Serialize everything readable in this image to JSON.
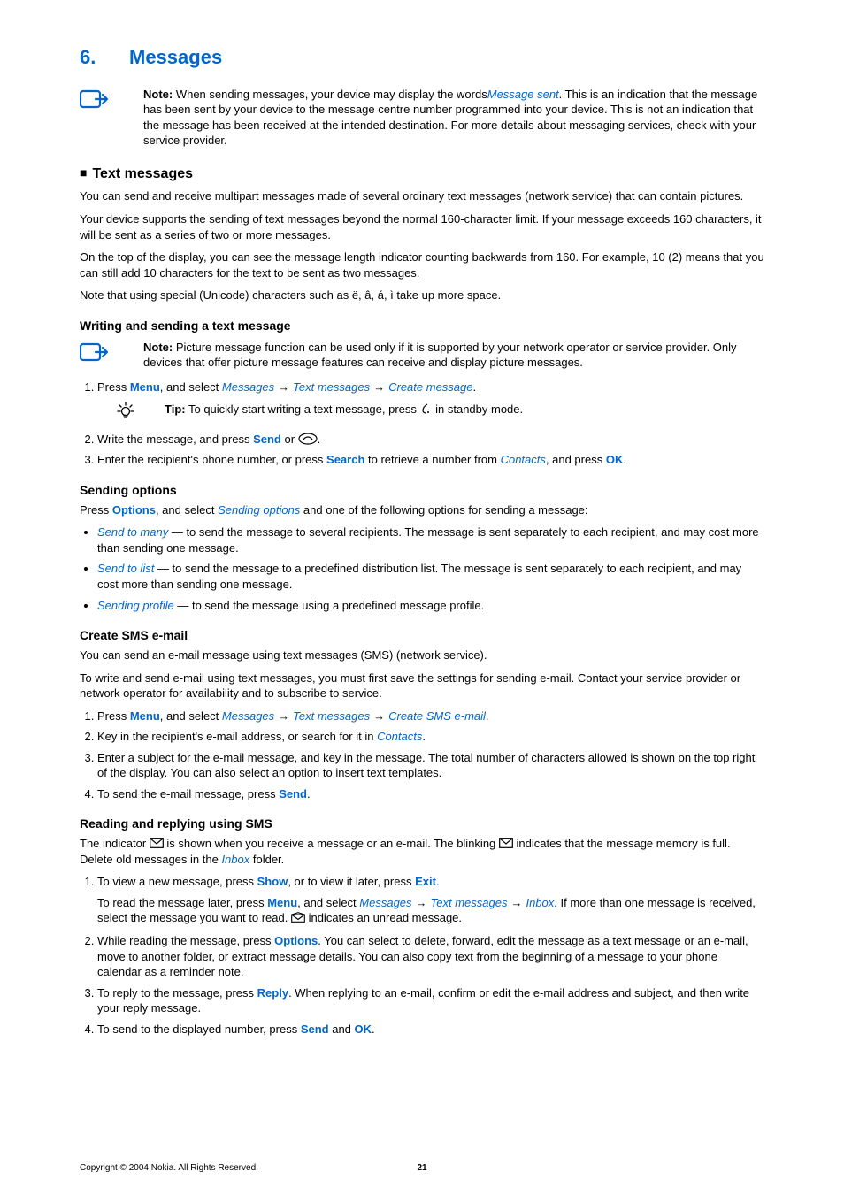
{
  "chapter": {
    "number": "6.",
    "title": "Messages"
  },
  "note1": {
    "label": "Note:",
    "text_before": " When sending messages, your device may display the words",
    "italic": "Message sent",
    "text_after": ". This is an indication that the message has been sent by your device to the message centre number programmed into your device. This is not an indication that the message has been received at the intended destination. For more details about messaging services, check with your service provider."
  },
  "section_text": {
    "title": "Text messages"
  },
  "p_intro1": "You can send and receive multipart messages made of several ordinary text messages (network service) that can contain pictures.",
  "p_intro2": "Your device supports the sending of text messages beyond the normal 160-character limit. If your message exceeds 160 characters, it will be sent as a series of two or more messages.",
  "p_intro3": "On the top of the display, you can see the message length indicator counting backwards from 160. For example, 10 (2) means that you can still add 10 characters for the text to be sent as two messages.",
  "p_intro4": "Note that using special (Unicode) characters such as ë, â, á, ì take up more space.",
  "writing": {
    "title": "Writing and sending a text message",
    "note": {
      "label": "Note:",
      "text": " Picture message function can be used only if it is supported by your network operator or service provider. Only devices that offer picture message features can receive and display picture messages."
    },
    "step1": {
      "prefix": "Press ",
      "menu": "Menu",
      "mid": ", and select ",
      "nav1": "Messages",
      "nav2": "Text messages",
      "nav3": "Create message",
      "period": "."
    },
    "tip": {
      "label": "Tip:",
      "text_before": " To quickly start writing a text message, press ",
      "text_after": " in standby mode."
    },
    "step2": {
      "prefix": "Write the message, and press ",
      "send": "Send",
      "mid": " or ",
      "period": "."
    },
    "step3": {
      "prefix": "Enter the recipient's phone number, or press ",
      "search": "Search",
      "mid": " to retrieve a number from ",
      "contacts": "Contacts",
      "mid2": ", and press ",
      "ok": "OK",
      "period": "."
    }
  },
  "sending_options": {
    "title": "Sending options",
    "intro_prefix": "Press ",
    "options": "Options",
    "intro_mid": ", and select ",
    "sending_opts": "Sending options",
    "intro_after": " and one of the following options for sending a message:",
    "b1_label": "Send to many",
    "b1_text": " — to send the message to several recipients. The message is sent separately to each recipient, and may cost more than sending one message.",
    "b2_label": "Send to list",
    "b2_text": " — to send the message to a predefined distribution list. The message is sent separately to each recipient, and may cost more than sending one message.",
    "b3_label": "Sending profile",
    "b3_text": " — to send the message using a predefined message profile."
  },
  "sms_email": {
    "title": "Create SMS e-mail",
    "p1": "You can send an e-mail message using text messages (SMS) (network service).",
    "p2": "To write and send e-mail using text messages, you must first save the settings for sending e-mail. Contact your service provider or network operator for availability and to subscribe to service.",
    "s1": {
      "prefix": "Press ",
      "menu": "Menu",
      "mid": ", and select ",
      "n1": "Messages",
      "n2": "Text messages",
      "n3": "Create SMS e-mail",
      "period": "."
    },
    "s2": {
      "prefix": "Key in the recipient's e-mail address, or search for it in ",
      "contacts": "Contacts",
      "period": "."
    },
    "s3": "Enter a subject for the e-mail message, and key in the message. The total number of characters allowed is shown on the top right of the display. You can also select an option to insert text templates.",
    "s4": {
      "prefix": "To send the e-mail message, press ",
      "send": "Send",
      "period": "."
    }
  },
  "reading": {
    "title": "Reading and replying using SMS",
    "p1_a": "The indicator ",
    "p1_b": " is shown when you receive a message or an e-mail. The blinking ",
    "p1_c": " indicates that the message memory is full. Delete old messages in the ",
    "inbox": "Inbox",
    "p1_d": " folder.",
    "s1": {
      "prefix": "To view a new message, press ",
      "show": "Show",
      "mid": ", or to view it later, press ",
      "exit": "Exit",
      "period": ".",
      "sub_a": "To read the message later, press ",
      "menu": "Menu",
      "sub_b": ", and select ",
      "n1": "Messages",
      "n2": "Text messages",
      "n3": "Inbox",
      "sub_c": ". If more than one message is received, select the message you want to read. ",
      "sub_d": " indicates an unread message."
    },
    "s2": {
      "prefix": "While reading the message, press ",
      "options": "Options",
      "after": ". You can select to delete, forward, edit the message as a text message or an e-mail, move to another folder, or extract message details. You can also copy text from the beginning of a message to your phone calendar as a reminder note."
    },
    "s3": {
      "prefix": "To reply to the message, press ",
      "reply": "Reply",
      "after": ". When replying to an e-mail, confirm or edit the e-mail address and subject, and then write your reply message."
    },
    "s4": {
      "prefix": "To send to the displayed number, press ",
      "send": "Send",
      "mid": " and ",
      "ok": "OK",
      "period": "."
    }
  },
  "footer": {
    "copyright": "Copyright © 2004 Nokia. All Rights Reserved.",
    "page": "21"
  }
}
